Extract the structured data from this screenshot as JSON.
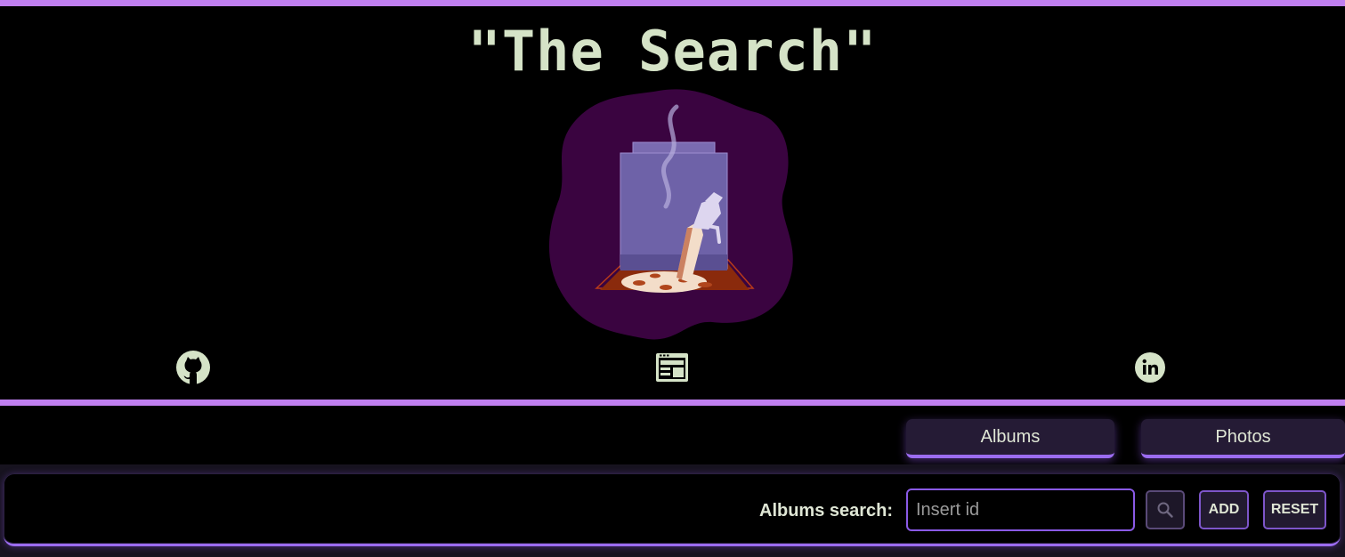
{
  "header": {
    "title": "\"The Search\""
  },
  "social_links": [
    {
      "name": "github",
      "icon": "github-icon"
    },
    {
      "name": "website",
      "icon": "website-icon"
    },
    {
      "name": "linkedin",
      "icon": "linkedin-icon"
    }
  ],
  "tabs": {
    "albums_label": "Albums",
    "photos_label": "Photos"
  },
  "search": {
    "label": "Albums search:",
    "placeholder": "Insert id",
    "value": "",
    "search_icon": "magnifier-icon",
    "add_label": "ADD",
    "reset_label": "RESET"
  },
  "colors": {
    "accent": "#c07ff0",
    "title_text": "#d5e3c7",
    "logo_blob": "#3a0440",
    "button_border": "#7d55c9"
  }
}
